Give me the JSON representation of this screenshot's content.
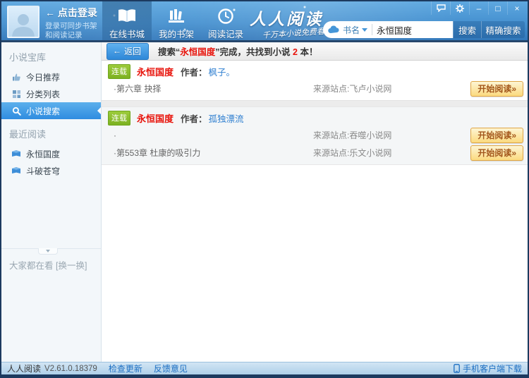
{
  "colors": {
    "header_blue": "#4691d0",
    "accent_blue": "#2f8ce0",
    "badge_green": "#7cb121",
    "title_red": "#e8130b",
    "read_button_yellow": "#fbda7f",
    "link_blue": "#1b6ec2"
  },
  "header": {
    "login": {
      "arrow": "←",
      "title": "点击登录",
      "subtitle1": "登录可同步书架",
      "subtitle2": "和阅读记录"
    },
    "tabs": [
      {
        "label": "在线书城"
      },
      {
        "label": "我的书架"
      },
      {
        "label": "阅读记录"
      }
    ],
    "logo": {
      "title": "人人阅读",
      "tagline": "千万本小说免费看!"
    },
    "search": {
      "category": "书名",
      "value": "永恒国度",
      "search_label": "搜索",
      "precise_label": "精确搜索"
    },
    "window_controls": {
      "minimize": "–",
      "maximize": "□",
      "close": "×"
    }
  },
  "sidebar": {
    "section1": "小说宝库",
    "items": [
      {
        "label": "今日推荐"
      },
      {
        "label": "分类列表"
      },
      {
        "label": "小说搜索"
      }
    ],
    "section2": "最近阅读",
    "recent": [
      {
        "label": "永恒国度"
      },
      {
        "label": "斗破苍穹"
      }
    ],
    "everyone": "大家都在看",
    "change": "[换一换]"
  },
  "toolbar": {
    "back_arrow": "←",
    "back": "返回",
    "s1": "搜索“",
    "keyword": "永恒国度",
    "s2": "”完成，共找到小说 ",
    "count": "2",
    "s3": " 本！"
  },
  "results": [
    {
      "badge": "连载",
      "title": "永恒国度",
      "author_label": "作者：",
      "author": "枫子。",
      "rows": [
        {
          "chapter": "·第六章 抉择",
          "source": "来源站点:飞卢小说网",
          "action": "开始阅读»"
        }
      ]
    },
    {
      "badge": "连载",
      "title": "永恒国度",
      "author_label": "作者：",
      "author": "孤独漂流",
      "rows": [
        {
          "chapter": "·",
          "source": "来源站点:吞噬小说网",
          "action": "开始阅读»"
        },
        {
          "chapter": "·第553章 杜康的吸引力",
          "source": "来源站点:乐文小说网",
          "action": "开始阅读»"
        }
      ]
    }
  ],
  "statusbar": {
    "app": "人人阅读",
    "version": "V2.61.0.18379",
    "check_update": "检查更新",
    "feedback": "反馈意见",
    "mobile": "手机客户端下载"
  }
}
